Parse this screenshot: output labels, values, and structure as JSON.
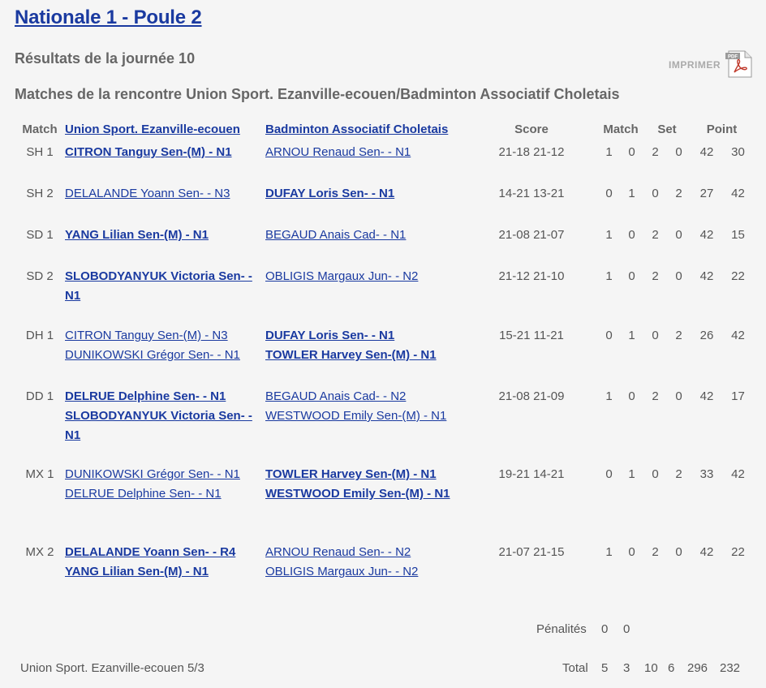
{
  "title": "Nationale 1 - Poule 2",
  "subtitle": "Résultats de la journée 10",
  "match_heading": "Matches de la rencontre Union Sport. Ezanville-ecouen/Badminton Associatif Choletais",
  "print_label": "IMPRIMER",
  "pdf_badge": "PDF",
  "headers": {
    "match": "Match",
    "team1": "Union Sport. Ezanville-ecouen",
    "team2": "Badminton Associatif Choletais",
    "score": "Score",
    "match_col": "Match",
    "set_col": "Set",
    "point_col": "Point"
  },
  "rows": [
    {
      "match": "SH 1",
      "t1": [
        {
          "name": "CITRON Tanguy Sen-(M) - N1",
          "bold": true
        }
      ],
      "t2": [
        {
          "name": "ARNOU Renaud Sen- - N1",
          "bold": false
        }
      ],
      "score": "21-18 21-12",
      "m1": "1",
      "m2": "0",
      "s1": "2",
      "s2": "0",
      "p1": "42",
      "p2": "30"
    },
    {
      "match": "SH 2",
      "t1": [
        {
          "name": "DELALANDE Yoann Sen- - N3",
          "bold": false
        }
      ],
      "t2": [
        {
          "name": "DUFAY Loris Sen- - N1",
          "bold": true
        }
      ],
      "score": "14-21 13-21",
      "m1": "0",
      "m2": "1",
      "s1": "0",
      "s2": "2",
      "p1": "27",
      "p2": "42"
    },
    {
      "match": "SD 1",
      "t1": [
        {
          "name": "YANG Lilian Sen-(M) - N1",
          "bold": true
        }
      ],
      "t2": [
        {
          "name": "BEGAUD Anais Cad- - N1",
          "bold": false
        }
      ],
      "score": "21-08 21-07",
      "m1": "1",
      "m2": "0",
      "s1": "2",
      "s2": "0",
      "p1": "42",
      "p2": "15"
    },
    {
      "match": "SD 2",
      "t1": [
        {
          "name": "SLOBODYANYUK Victoria Sen- - N1",
          "bold": true
        }
      ],
      "t2": [
        {
          "name": "OBLIGIS Margaux Jun- - N2",
          "bold": false
        }
      ],
      "score": "21-12 21-10",
      "m1": "1",
      "m2": "0",
      "s1": "2",
      "s2": "0",
      "p1": "42",
      "p2": "22"
    },
    {
      "match": "DH 1",
      "t1": [
        {
          "name": "CITRON Tanguy Sen-(M) - N3",
          "bold": false
        },
        {
          "name": "DUNIKOWSKI Grégor Sen- - N1",
          "bold": false
        }
      ],
      "t2": [
        {
          "name": "DUFAY Loris Sen- - N1",
          "bold": true
        },
        {
          "name": "TOWLER Harvey Sen-(M) - N1",
          "bold": true
        }
      ],
      "score": "15-21 11-21",
      "m1": "0",
      "m2": "1",
      "s1": "0",
      "s2": "2",
      "p1": "26",
      "p2": "42"
    },
    {
      "match": "DD 1",
      "t1": [
        {
          "name": "DELRUE Delphine Sen- - N1",
          "bold": true
        },
        {
          "name": "SLOBODYANYUK Victoria Sen- - N1",
          "bold": true
        }
      ],
      "t2": [
        {
          "name": "BEGAUD Anais Cad- - N2",
          "bold": false
        },
        {
          "name": "WESTWOOD Emily Sen-(M) - N1",
          "bold": false
        }
      ],
      "score": "21-08 21-09",
      "m1": "1",
      "m2": "0",
      "s1": "2",
      "s2": "0",
      "p1": "42",
      "p2": "17"
    },
    {
      "match": "MX 1",
      "t1": [
        {
          "name": "DUNIKOWSKI Grégor Sen- - N1",
          "bold": false
        },
        {
          "name": "DELRUE Delphine Sen- - N1",
          "bold": false
        }
      ],
      "t2": [
        {
          "name": "TOWLER Harvey Sen-(M) - N1",
          "bold": true
        },
        {
          "name": "WESTWOOD Emily Sen-(M) - N1",
          "bold": true
        }
      ],
      "score": "19-21 14-21",
      "m1": "0",
      "m2": "1",
      "s1": "0",
      "s2": "2",
      "p1": "33",
      "p2": "42"
    },
    {
      "match": "MX 2",
      "t1": [
        {
          "name": "DELALANDE Yoann Sen- - R4",
          "bold": true
        },
        {
          "name": "YANG Lilian Sen-(M) - N1",
          "bold": true
        }
      ],
      "t2": [
        {
          "name": "ARNOU Renaud Sen- - N2",
          "bold": false
        },
        {
          "name": "OBLIGIS Margaux Jun- - N2",
          "bold": false
        }
      ],
      "score": "21-07 21-15",
      "m1": "1",
      "m2": "0",
      "s1": "2",
      "s2": "0",
      "p1": "42",
      "p2": "22"
    }
  ],
  "penalties": {
    "label": "Pénalités",
    "v1": "0",
    "v2": "0"
  },
  "footer": {
    "team_record": "Union Sport. Ezanville-ecouen 5/3",
    "total_label": "Total",
    "m1": "5",
    "m2": "3",
    "s1": "10",
    "s2": "6",
    "p1": "296",
    "p2": "232"
  }
}
